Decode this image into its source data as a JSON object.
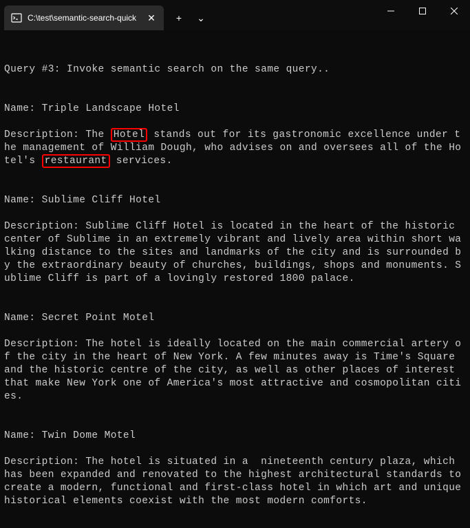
{
  "titlebar": {
    "tab_title": "C:\\test\\semantic-search-quick",
    "tab_icon": "terminal-icon",
    "close_label": "✕",
    "new_tab_label": "+",
    "dropdown_label": "⌄"
  },
  "window_controls": {
    "minimize": "─",
    "maximize": "☐",
    "close": "✕"
  },
  "terminal": {
    "line1": "",
    "query_header": "Query #3: Invoke semantic search on the same query..",
    "blank1": "",
    "item1_name": "Name: Triple Landscape Hotel",
    "item1_desc_pre": "Description: The ",
    "item1_highlight1": "Hotel",
    "item1_desc_mid": " stands out for its gastronomic excellence under the management of William Dough, who advises on and oversees all of the Hotel's ",
    "item1_highlight2": "restaurant",
    "item1_desc_post": " services.",
    "blank2": "",
    "item2_name": "Name: Sublime Cliff Hotel",
    "item2_desc": "Description: Sublime Cliff Hotel is located in the heart of the historic center of Sublime in an extremely vibrant and lively area within short walking distance to the sites and landmarks of the city and is surrounded by the extraordinary beauty of churches, buildings, shops and monuments. Sublime Cliff is part of a lovingly restored 1800 palace.",
    "blank3": "",
    "item3_name": "Name: Secret Point Motel",
    "item3_desc": "Description: The hotel is ideally located on the main commercial artery of the city in the heart of New York. A few minutes away is Time's Square and the historic centre of the city, as well as other places of interest that make New York one of America's most attractive and cosmopolitan cities.",
    "blank4": "",
    "item4_name": "Name: Twin Dome Motel",
    "item4_desc": "Description: The hotel is situated in a  nineteenth century plaza, which has been expanded and renovated to the highest architectural standards to create a modern, functional and first-class hotel in which art and unique historical elements coexist with the most modern comforts."
  }
}
